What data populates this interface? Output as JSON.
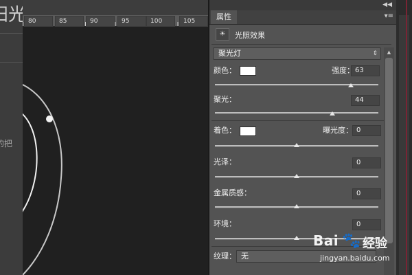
{
  "page": {
    "title_fragment": "阳光",
    "body_fragment": "的把"
  },
  "ruler": {
    "ticks": [
      "80",
      "85",
      "90",
      "95",
      "100",
      "105"
    ]
  },
  "panel": {
    "tab_label": "属性",
    "menu_glyph": "▾≡",
    "top_glyph": "◀◀",
    "effect_title": "光照效果",
    "effect_icon": "☀",
    "light_type": "聚光灯",
    "light_type_arrow": "⇕",
    "color_label": "颜色：",
    "color_value": "#ffffff",
    "intensity_label": "强度：",
    "intensity_value": "63",
    "hotspot_label": "聚光：",
    "hotspot_value": "44",
    "tint_label": "着色：",
    "tint_color": "#ffffff",
    "exposure_label": "曝光度：",
    "exposure_value": "0",
    "gloss_label": "光泽：",
    "gloss_value": "0",
    "metallic_label": "金属质感：",
    "metallic_value": "0",
    "ambience_label": "环境：",
    "ambience_value": "0",
    "texture_label": "纹理：",
    "texture_value": "无"
  },
  "sliders": {
    "intensity": 0.83,
    "hotspot": 0.72,
    "exposure": 0.5,
    "gloss": 0.5,
    "metallic": 0.5,
    "ambience": 0.5
  },
  "scrollbar": {
    "up_arrow": "▲"
  },
  "watermark": {
    "brand_left": "Bai",
    "brand_right": "经验",
    "paw": "🐾",
    "url": "jingyan.baidu.com"
  }
}
